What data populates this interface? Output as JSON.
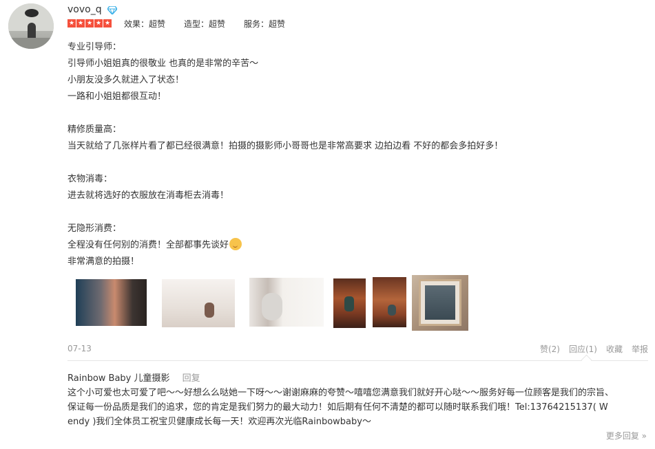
{
  "review": {
    "username": "vovo_q",
    "badge_icon": "diamond-icon",
    "rating_stars": 5,
    "scores": [
      "效果：超赞",
      "造型：超赞",
      "服务：超赞"
    ],
    "lines": [
      "专业引导师：",
      "引导师小姐姐真的很敬业 也真的是非常的辛苦～",
      "小朋友没多久就进入了状态！",
      "一路和小姐姐都很互动！",
      "",
      "精修质量高：",
      "当天就给了几张样片看了都已经很满意！拍摄的摄影师小哥哥也是非常高要求 边拍边看 不好的都会多拍好多！",
      "",
      "衣物消毒：",
      "进去就将选好的衣服放在消毒柜去消毒！",
      "",
      "无隐形消费：",
      "全程没有任何别的消费！全部都事先谈好",
      "非常满意的拍摄！"
    ],
    "emoji_icon": "smile-emoji-icon",
    "photo_count": 6,
    "date": "07-13",
    "actions": [
      "赞(2)",
      "回应(1)",
      "收藏",
      "举报"
    ]
  },
  "reply": {
    "author": "Rainbow Baby 儿童摄影",
    "reply_link": "回复",
    "lines": [
      "这个小可爱也太可爱了吧～～好想么么哒她一下呀～～谢谢麻麻的夸赞～嘻嘻您满意我们就好开心哒～～服务好每一位顾客是我们的宗旨、",
      "保证每一份品质是我们的追求，您的肯定是我们努力的最大动力！如后期有任何不清楚的都可以随时联系我们哦！Tel:13764215137( W",
      "endy )我们全体员工祝宝贝健康成长每一天！欢迎再次光临Rainbowbaby～"
    ]
  },
  "more_replies": "更多回复 »",
  "colors": {
    "star": "#f5503c",
    "text": "#333333",
    "muted": "#999999",
    "diamond": "#3ab0e8"
  }
}
